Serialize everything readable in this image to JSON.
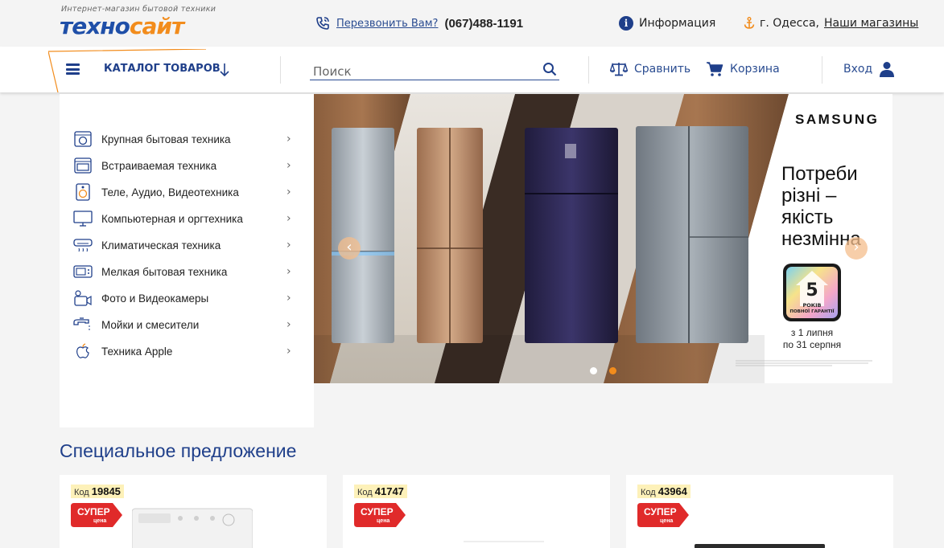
{
  "header": {
    "logo": {
      "tagline": "Интернет-магазин бытовой техники",
      "word_part1": "техно",
      "word_part2": "сайт"
    },
    "callback_label": "Перезвонить Вам?",
    "phone": "(067)488-1191",
    "info_label": "Информация",
    "city_label": "г. Одесса,",
    "stores_label": "Наши магазины"
  },
  "nav": {
    "catalog_label": "КАТАЛОГ ТОВАРОВ",
    "search_placeholder": "Поиск",
    "compare_label": "Сравнить",
    "cart_label": "Корзина",
    "login_label": "Вход"
  },
  "sidebar": {
    "items": [
      {
        "label": "Крупная бытовая техника",
        "icon": "washing-machine-icon"
      },
      {
        "label": "Встраиваемая техника",
        "icon": "oven-icon"
      },
      {
        "label": "Теле, Аудио, Видеотехника",
        "icon": "speaker-icon"
      },
      {
        "label": "Компьютерная и оргтехника",
        "icon": "monitor-icon"
      },
      {
        "label": "Климатическая техника",
        "icon": "air-conditioner-icon"
      },
      {
        "label": "Мелкая бытовая техника",
        "icon": "microwave-icon"
      },
      {
        "label": "Фото и Видеокамеры",
        "icon": "camera-icon"
      },
      {
        "label": "Мойки и смесители",
        "icon": "faucet-icon"
      },
      {
        "label": "Техника Apple",
        "icon": "apple-icon"
      }
    ]
  },
  "banner": {
    "brand": "SAMSUNG",
    "headline": [
      "Потреби",
      "різні –",
      "якість",
      "незмінна"
    ],
    "warranty_years": "5",
    "warranty_line1": "РОКІВ",
    "warranty_line2": "ПОВНОЇ ГАРАНТІЇ",
    "dates": [
      "з 1 липня",
      "по 31 серпня"
    ],
    "slides_total": 2,
    "active_slide": 2
  },
  "special": {
    "title": "Специальное предложение",
    "products": [
      {
        "code_prefix": "Код",
        "code": "19845",
        "badge1": "СУПЕР",
        "badge2": "цена"
      },
      {
        "code_prefix": "Код",
        "code": "41747",
        "badge1": "СУПЕР",
        "badge2": "цена"
      },
      {
        "code_prefix": "Код",
        "code": "43964",
        "badge1": "СУПЕР",
        "badge2": "цена"
      }
    ]
  },
  "colors": {
    "brand_blue": "#1f3f8a",
    "brand_orange": "#f28c1c",
    "badge_red": "#e02a2a",
    "code_badge_bg": "#fdf1b9"
  }
}
